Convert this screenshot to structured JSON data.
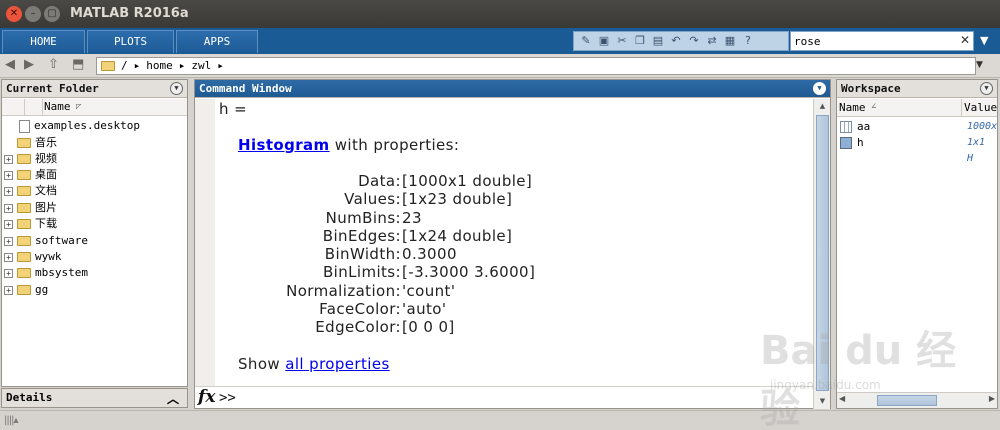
{
  "window": {
    "title": "MATLAB R2016a"
  },
  "toolstrip": {
    "tabs": [
      {
        "label": "HOME"
      },
      {
        "label": "PLOTS"
      },
      {
        "label": "APPS"
      }
    ],
    "search": {
      "value": "rose"
    }
  },
  "address": {
    "segments": [
      "/",
      "home",
      "zwl"
    ]
  },
  "current_folder": {
    "title": "Current Folder",
    "column_name": "Name",
    "items": [
      {
        "name": "examples.desktop",
        "type": "file"
      },
      {
        "name": "音乐",
        "type": "folder"
      },
      {
        "name": "视频",
        "type": "folder"
      },
      {
        "name": "桌面",
        "type": "folder"
      },
      {
        "name": "文档",
        "type": "folder"
      },
      {
        "name": "图片",
        "type": "folder"
      },
      {
        "name": "下载",
        "type": "folder"
      },
      {
        "name": "software",
        "type": "folder"
      },
      {
        "name": "wywk",
        "type": "folder"
      },
      {
        "name": "mbsystem",
        "type": "folder"
      },
      {
        "name": "gg",
        "type": "folder"
      }
    ],
    "details_label": "Details"
  },
  "command_window": {
    "title": "Command Window",
    "var_line": "h =",
    "class_link": "Histogram",
    "class_suffix": " with properties:",
    "properties": [
      {
        "key": "Data",
        "value": "[1000x1 double]"
      },
      {
        "key": "Values",
        "value": "[1x23 double]"
      },
      {
        "key": "NumBins",
        "value": "23"
      },
      {
        "key": "BinEdges",
        "value": "[1x24 double]"
      },
      {
        "key": "BinWidth",
        "value": "0.3000"
      },
      {
        "key": "BinLimits",
        "value": "[-3.3000 3.6000]"
      },
      {
        "key": "Normalization",
        "value": "'count'"
      },
      {
        "key": "FaceColor",
        "value": "'auto'"
      },
      {
        "key": "EdgeColor",
        "value": "[0 0 0]"
      }
    ],
    "show_prefix": "Show ",
    "show_link": "all properties",
    "prompt": ">>",
    "fx_label": "fx"
  },
  "workspace": {
    "title": "Workspace",
    "columns": {
      "name": "Name",
      "value": "Value"
    },
    "variables": [
      {
        "name": "aa",
        "value": "1000x"
      },
      {
        "name": "h",
        "value": "1x1 H"
      }
    ]
  },
  "watermark": {
    "brand": "Bai du 经验",
    "url": "jingyan.baidu.com"
  },
  "colors": {
    "tab_bar": "#1a5a95",
    "active_panel_header": "#1f5a93",
    "link": "#0000ee",
    "folder": "#f2d37a"
  }
}
